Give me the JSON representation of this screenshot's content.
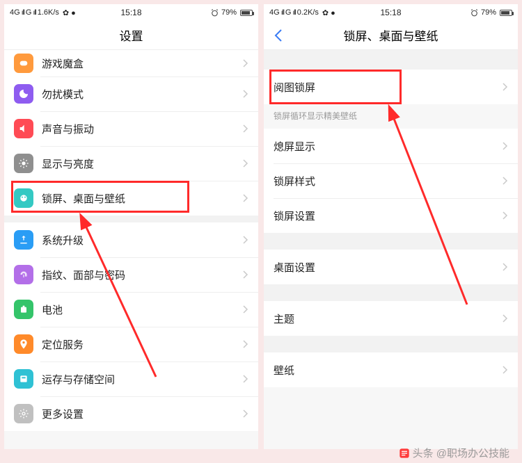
{
  "status": {
    "net_label_4g": "4G",
    "net_label_g": "G",
    "speed_left": "1.6K/s",
    "speed_right": "0.2K/s",
    "time": "15:18",
    "battery_pct": "79%"
  },
  "left": {
    "title": "设置",
    "rows": [
      {
        "label": "游戏魔盒",
        "icon": "game-box-icon",
        "color": "#ff9a3d"
      },
      {
        "label": "勿扰模式",
        "icon": "do-not-disturb-icon",
        "color": "#8e5cf0"
      },
      {
        "label": "声音与振动",
        "icon": "sound-icon",
        "color": "#ff4b55"
      },
      {
        "label": "显示与亮度",
        "icon": "brightness-icon",
        "color": "#8f8f8f"
      },
      {
        "label": "锁屏、桌面与壁纸",
        "icon": "wallpaper-icon",
        "color": "#34c9c3"
      },
      {
        "label": "系统升级",
        "icon": "system-update-icon",
        "color": "#2a9df5"
      },
      {
        "label": "指纹、面部与密码",
        "icon": "fingerprint-icon",
        "color": "#b36fe8"
      },
      {
        "label": "电池",
        "icon": "battery-icon",
        "color": "#34c46a"
      },
      {
        "label": "定位服务",
        "icon": "location-icon",
        "color": "#ff8a2a"
      },
      {
        "label": "运存与存储空间",
        "icon": "storage-icon",
        "color": "#2fc1d4"
      },
      {
        "label": "更多设置",
        "icon": "more-settings-icon",
        "color": "#c0c0c0"
      }
    ]
  },
  "right": {
    "title": "锁屏、桌面与壁纸",
    "row_yuetu": "阅图锁屏",
    "caption": "锁屏循环显示精美壁纸",
    "group2": [
      "熄屏显示",
      "锁屏样式",
      "锁屏设置"
    ],
    "group3": [
      "桌面设置"
    ],
    "group4": [
      "主题"
    ],
    "group5": [
      "壁纸"
    ]
  },
  "footer": "头条 @职场办公技能"
}
